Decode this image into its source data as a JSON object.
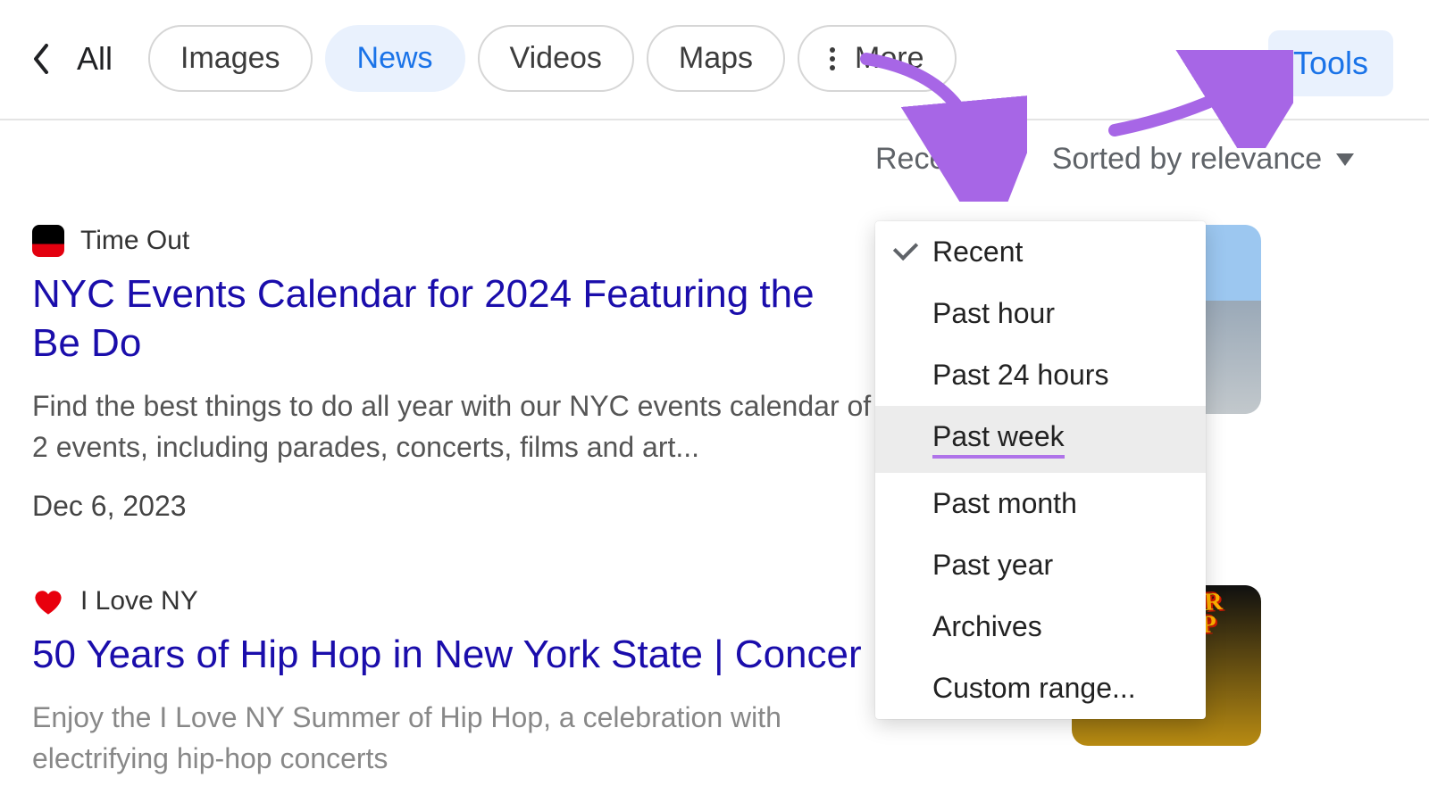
{
  "tabs": {
    "all": "All",
    "images": "Images",
    "news": "News",
    "videos": "Videos",
    "maps": "Maps",
    "more": "More"
  },
  "tools": "Tools",
  "filters": {
    "recent": "Recent",
    "sort": "Sorted by relevance"
  },
  "dropdown": {
    "items": [
      "Recent",
      "Past hour",
      "Past 24 hours",
      "Past week",
      "Past month",
      "Past year",
      "Archives",
      "Custom range..."
    ]
  },
  "results": [
    {
      "source": "Time Out",
      "title": "NYC Events Calendar for 2024 Featuring the Be Do",
      "snippet": "Find the best things to do all year with our NYC events calendar of 2 events, including parades, concerts, films and art...",
      "date": "Dec 6, 2023"
    },
    {
      "source": "I Love NY",
      "title": "50 Years of Hip Hop in New York State | Concer",
      "snippet": "Enjoy the I Love NY Summer of Hip Hop, a celebration with electrifying hip-hop concerts",
      "thumb_text": "SUMMER HIPHOP"
    }
  ]
}
